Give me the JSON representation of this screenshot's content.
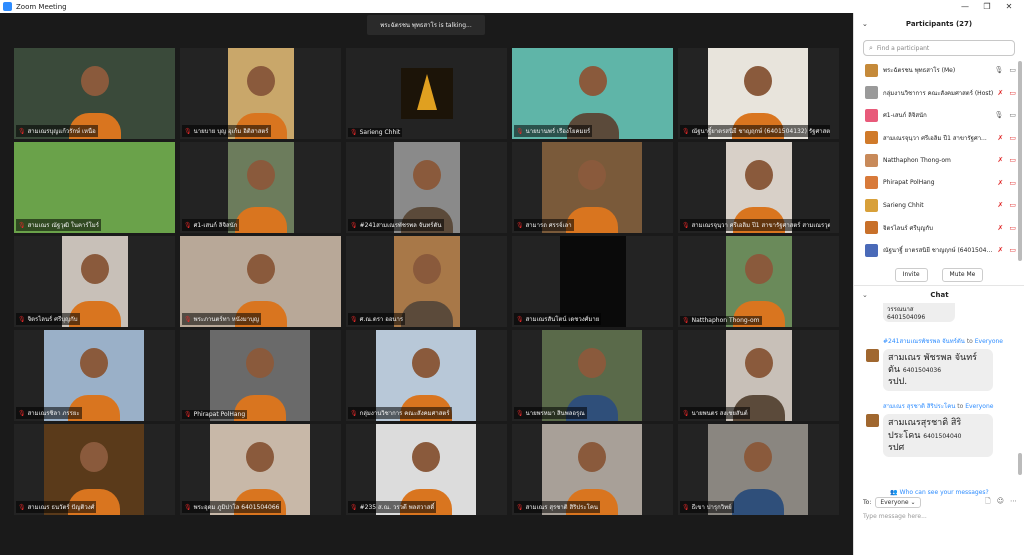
{
  "window": {
    "title": "Zoom Meeting",
    "controls": [
      "—",
      "❐",
      "✕"
    ]
  },
  "talking_indicator": "พระฉัตรชน พุทธสาโร is talking...",
  "tiles": [
    {
      "name": "สามเณรบุญแก้วรักษ์ เหนือ",
      "bg": "#3a4a3a",
      "style": "full",
      "robe": "orange"
    },
    {
      "name": "นายบาย บุญ อุเก้ม อิติสาสตร์",
      "bg": "#c9a76a",
      "style": "mid",
      "robe": "orange"
    },
    {
      "name": "Sarieng Chhit",
      "bg": "#1c1408",
      "style": "temple",
      "robe": "none"
    },
    {
      "name": "นายบานพร์ เรืองโยคมยร์",
      "bg": "#5fb5a8",
      "style": "full",
      "robe": "dark"
    },
    {
      "name": "ณัฐนาฐิ์ยาตรสนิยี ชาญฤกษ์ (6401504132) รัฐศาสตร์",
      "bg": "#e8e4dc",
      "style": "wide",
      "robe": "orange"
    },
    {
      "name": "สามเณร ณัฐวุฒิ ในคาร์โมร์",
      "bg": "#6aa24a",
      "style": "full",
      "robe": "none"
    },
    {
      "name": "ศ1-เสนก์ ลิจิสนัก",
      "bg": "#6c7c5c",
      "style": "mid",
      "robe": "orange"
    },
    {
      "name": "#241สามเณรพัชรพล จันทร์ตัน",
      "bg": "#8a8a8a",
      "style": "mid",
      "robe": "dark"
    },
    {
      "name": "สามารถ ศรรจ์เลา",
      "bg": "#7a5a3a",
      "style": "wide",
      "robe": "orange"
    },
    {
      "name": "สามเณรจุนฺวา ศรีเอลิม ปี1 สาขารัฐศาสตร์ สามเณรวุฒา ศรี...",
      "bg": "#d8d0c8",
      "style": "mid",
      "robe": "orange"
    },
    {
      "name": "จิตรไลนร์ ศรีบุญกับ",
      "bg": "#c8c0b8",
      "style": "mid",
      "robe": "orange"
    },
    {
      "name": "พระภานตร์ทา หนังมาบุญ",
      "bg": "#b8a898",
      "style": "full",
      "robe": "orange"
    },
    {
      "name": "ศ.ณ.ดรา ออนาร",
      "bg": "#a87848",
      "style": "mid",
      "robe": "dark"
    },
    {
      "name": "สามเณรสันโตน์ เดชวงศ์มาย",
      "bg": "#0a0a0a",
      "style": "mid",
      "robe": "none"
    },
    {
      "name": "Natthaphon Thong-om",
      "bg": "#6a8a5a",
      "style": "mid",
      "robe": "orange"
    },
    {
      "name": "สามเณรซิลา ภรรยะ",
      "bg": "#9ab0c8",
      "style": "wide",
      "robe": "orange"
    },
    {
      "name": "Phirapat PolHang",
      "bg": "#6a6a6a",
      "style": "wide",
      "robe": "orange"
    },
    {
      "name": "กลุ่มงานวิชาการ คณะสังคมศาสตร์",
      "bg": "#b8c8d8",
      "style": "wide",
      "robe": "orange"
    },
    {
      "name": "นายพรหมา สินพลอรุณ",
      "bg": "#5a6a4a",
      "style": "wide",
      "robe": "blue"
    },
    {
      "name": "นายพนตร สงเชยสันต์",
      "bg": "#c8c0b8",
      "style": "mid",
      "robe": "dark"
    },
    {
      "name": "สามเณร ธนวัตร์ ปัญติวงศ์",
      "bg": "#5a3a1a",
      "style": "wide",
      "robe": "orange"
    },
    {
      "name": "พระอุดม ภูมิปาโล 6401504066",
      "bg": "#c8b8a8",
      "style": "wide",
      "robe": "orange"
    },
    {
      "name": "#235 ส.ณ. วรวดี พลสวาสดิ์",
      "bg": "#dcdcdc",
      "style": "wide",
      "robe": "orange"
    },
    {
      "name": "สามเณร สุรชาติ สิริประโคน",
      "bg": "#a8a098",
      "style": "wide",
      "robe": "orange"
    },
    {
      "name": "ธีเขา ปารุกวิทย์",
      "bg": "#8a8680",
      "style": "wide",
      "robe": "blue"
    }
  ],
  "participants_panel": {
    "header": "Participants (27)",
    "search_placeholder": "Find a participant",
    "participants": [
      {
        "name": "พระฉัตรชน พุทธสาโร (Me)",
        "avatar": "#c58a3a",
        "mic": "on",
        "video": "on"
      },
      {
        "name": "กลุ่มงานวิชาการ คณะสังคมศาสตร์ (Host)",
        "avatar": "#9a9a9a",
        "mic": "off",
        "video": "off"
      },
      {
        "name": "ศ1-เสนก์ ลิจิสนัก",
        "avatar": "#e85a7a",
        "mic": "on",
        "video": "on"
      },
      {
        "name": "สามเณรจุนฺวา ศรีเอลิม ปี1 สาขารัฐศา...",
        "avatar": "#d07a2a",
        "mic": "off",
        "video": "off"
      },
      {
        "name": "Natthaphon Thong-om",
        "avatar": "#c88a5a",
        "mic": "off",
        "video": "off"
      },
      {
        "name": "Phirapat PolHang",
        "avatar": "#d87a3a",
        "mic": "off",
        "video": "off"
      },
      {
        "name": "Sarieng Chhit",
        "avatar": "#d8a03a",
        "mic": "off",
        "video": "off"
      },
      {
        "name": "จิตรไลนร์ ศรีบุญกับ",
        "avatar": "#c8702a",
        "mic": "off",
        "video": "off"
      },
      {
        "name": "ณัฐนาฐิ์ ยาตรสนิยี ชาญฤกษ์ (6401504...",
        "avatar": "#4a6ab8",
        "mic": "off",
        "video": "off"
      }
    ],
    "invite_label": "Invite",
    "mute_me_label": "Mute Me"
  },
  "chat": {
    "header": "Chat",
    "partial_top": "วรรณนาส 6401504096",
    "messages": [
      {
        "sender": "#241สามเณรพัชรพล จันทร์ตัน",
        "to_prefix": "to",
        "to": "Everyone",
        "text": "สามเณร พัชรพล จันทร์ตัน",
        "id": "6401504036",
        "tail": "รปป."
      },
      {
        "sender": "สามเณร สุรชาติ สิริประโคน",
        "to_prefix": "to",
        "to": "Everyone",
        "text": "สามเณรสุรชาติ สิริประโคน",
        "id": "6401504040",
        "tail": "รปศ"
      }
    ],
    "who_can_see": "Who can see your messages?",
    "to_label": "To:",
    "to_value": "Everyone",
    "input_placeholder": "Type message here..."
  }
}
